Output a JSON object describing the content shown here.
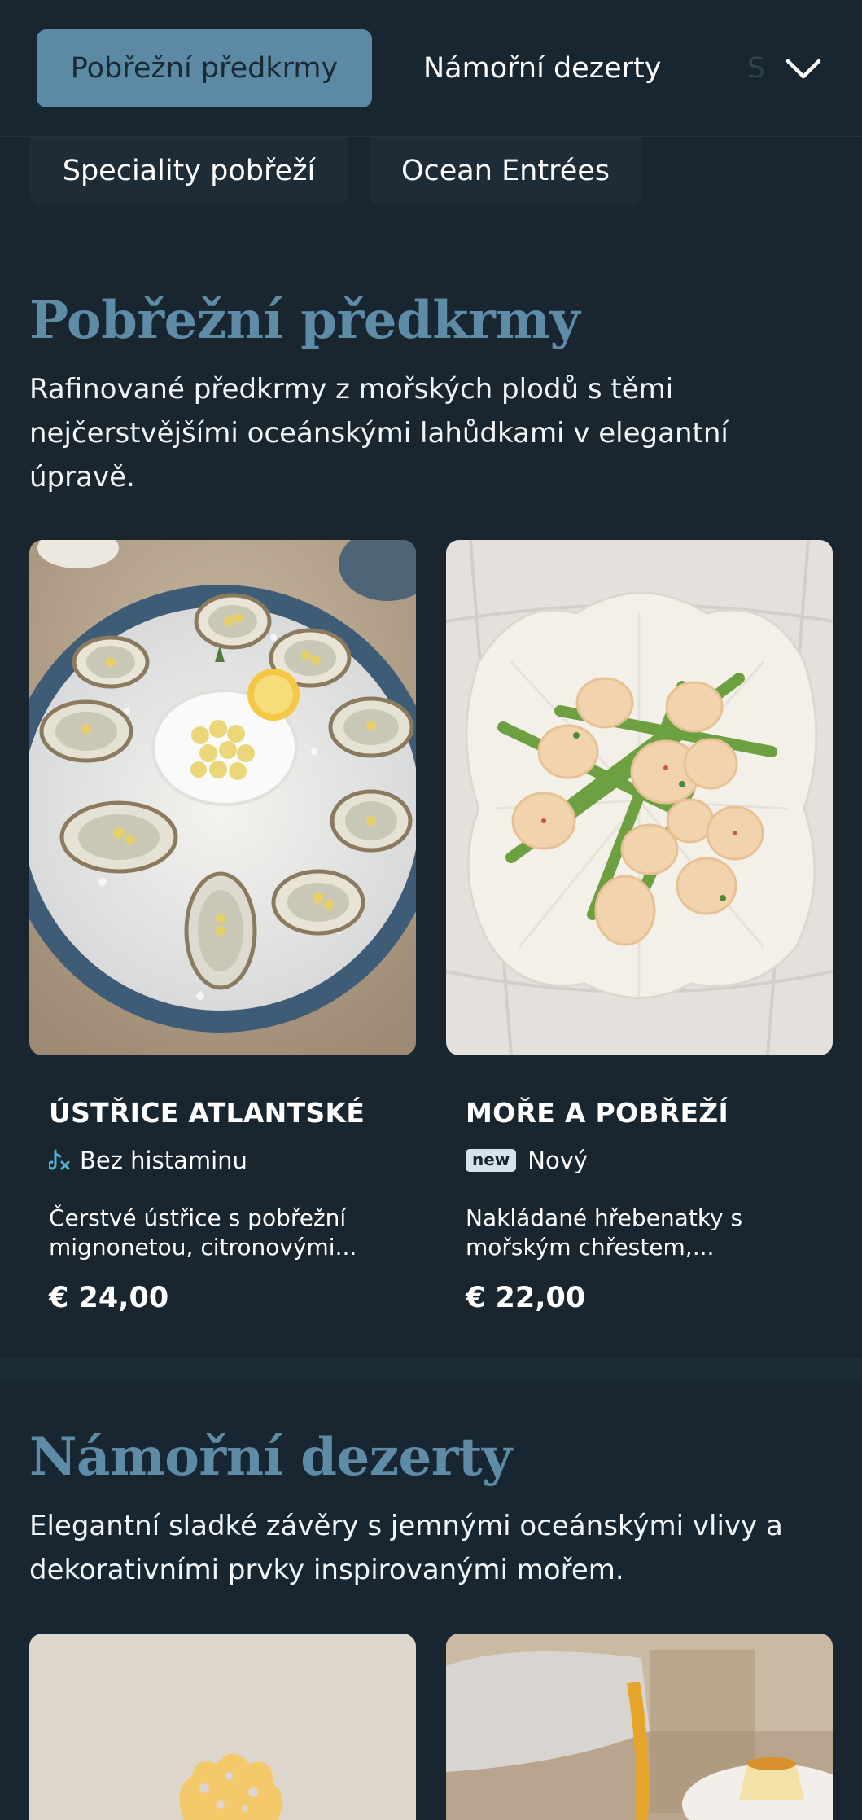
{
  "category_nav": {
    "tabs": [
      {
        "label": "Pobřežní předkrmy"
      },
      {
        "label": "Námořní dezerty"
      },
      {
        "label": "S"
      }
    ],
    "chips": [
      {
        "label": "Speciality pobřeží"
      },
      {
        "label": "Ocean Entrées"
      }
    ],
    "expand_icon": "chevron-down-icon"
  },
  "sections": [
    {
      "title": "Pobřežní předkrmy",
      "description": "Rafinované předkrmy z mořských plodů s těmi nejčerstvějšími oceánskými lahůdkami v elegantní úpravě.",
      "items": [
        {
          "name": "ÚSTŘICE ATLANTSKÉ",
          "tag_icon": "no-histamine-icon",
          "tag": "Bez histaminu",
          "description": "Čerstvé ústřice s pobřežní mignonetou, citronovými...",
          "price": "€ 24,00"
        },
        {
          "name": "MOŘE A POBŘEŽÍ",
          "tag_badge": "new",
          "tag": "Nový",
          "description": "Nakládané hřebenatky s mořským chřestem,...",
          "price": "€ 22,00"
        }
      ]
    },
    {
      "title": "Námořní dezerty",
      "description": "Elegantní sladké závěry s jemnými oceánskými vlivy a dekorativními prvky inspirovanými mořem."
    }
  ],
  "colors": {
    "background": "#19262f",
    "accent": "#5c8aa4",
    "section_title": "#5e8ba6"
  }
}
